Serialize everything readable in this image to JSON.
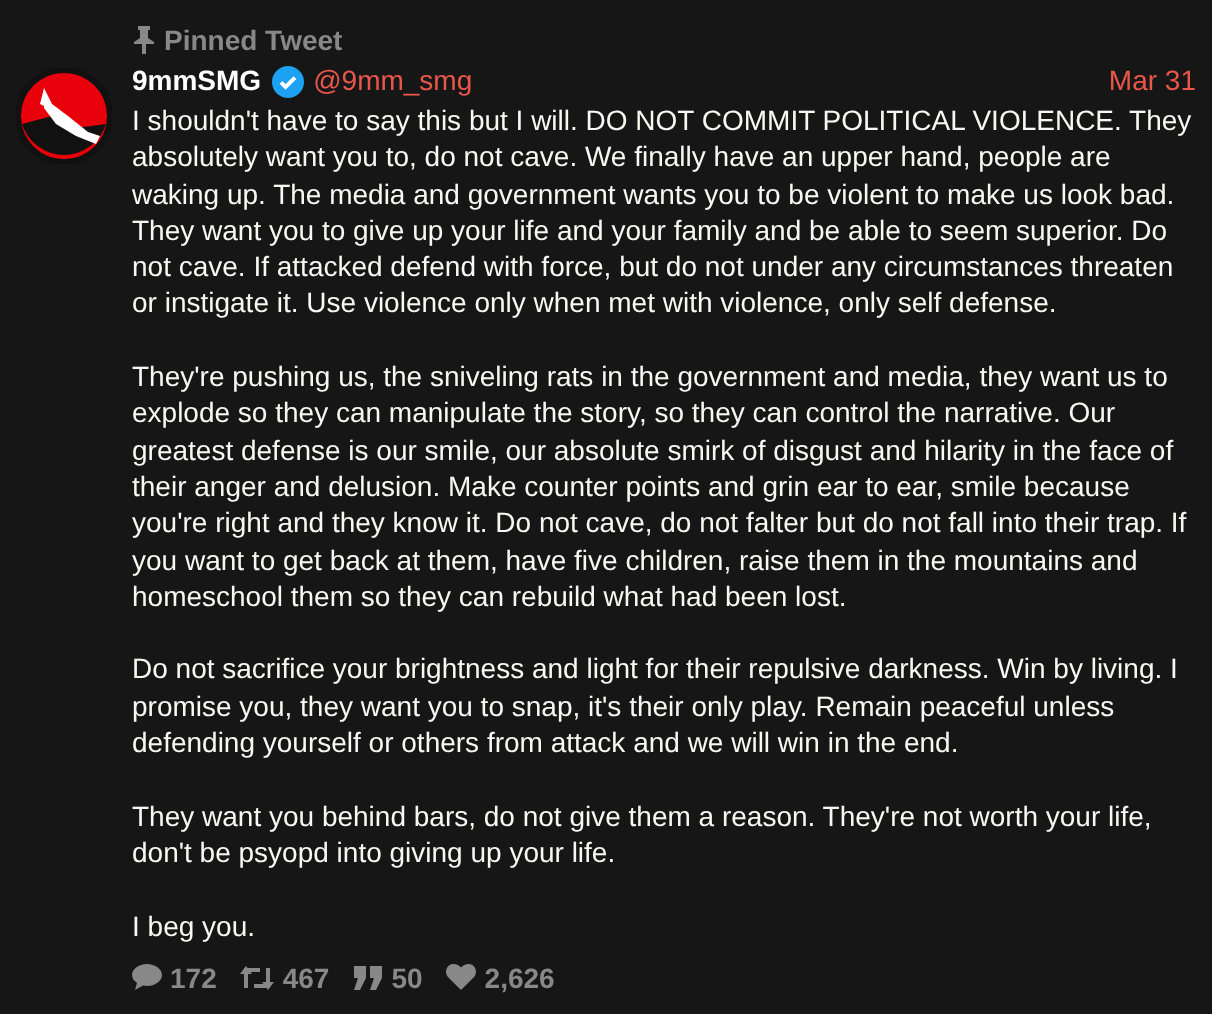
{
  "pinned_label": "Pinned Tweet",
  "author": {
    "name": "9mmSMG",
    "verified": true,
    "handle": "@9mm_smg"
  },
  "date": "Mar 31",
  "paragraphs": [
    "I shouldn't have to say this but I will. DO NOT COMMIT POLITICAL VIOLENCE. They absolutely want you to, do not cave. We finally have an upper hand, people are waking up. The media and government wants you to be violent to make us look bad. They want you to give up your life and your family and be able to seem superior. Do not cave. If attacked defend with force, but do not under any circumstances threaten or instigate it. Use violence only when met with violence, only self defense.",
    "They're pushing us, the sniveling rats in the government and media, they want us to explode so they can manipulate the story, so they can control the narrative. Our greatest defense is our smile, our absolute smirk of disgust and hilarity in the face of their anger and delusion. Make counter points and grin ear to ear, smile because you're right and they know it. Do not cave, do not falter but do not fall into their trap. If you want to get back at them, have five children, raise them in the mountains and homeschool them so they can rebuild what had been lost.",
    "Do not sacrifice your brightness and light for their repulsive darkness. Win by living. I promise you, they want you to snap, it's their only play. Remain peaceful unless defending yourself or others from attack and we will win in the end.",
    "They want you behind bars, do not give them a reason. They're not worth your life, don't be psyopd into giving up your life.",
    "I beg you."
  ],
  "stats": [
    {
      "kind": "replies",
      "count": "172"
    },
    {
      "kind": "retweets",
      "count": "467"
    },
    {
      "kind": "quotes",
      "count": "50"
    },
    {
      "kind": "likes",
      "count": "2,626"
    }
  ]
}
